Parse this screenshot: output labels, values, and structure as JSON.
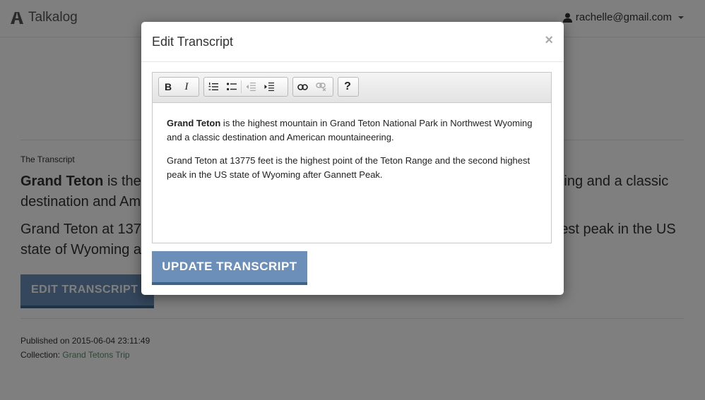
{
  "app": {
    "brand": "Talkalog",
    "user_email": "rachelle@gmail.com"
  },
  "page": {
    "section_label": "The Transcript",
    "paragraph1_bold": "Grand Teton",
    "paragraph1_rest": " is the highest mountain in Grand Teton National Park in Northwest Wyoming and a classic destination and American mountaineering.",
    "paragraph2": "Grand Teton at 13775 feet is the highest point of the Teton Range and the second highest peak in the US state of Wyoming after Gannett Peak.",
    "edit_button": "EDIT TRANSCRIPT",
    "published_label": "Published on 2015-06-04 23:11:49",
    "collection_label": "Collection: ",
    "collection_link": "Grand Tetons Trip"
  },
  "modal": {
    "title": "Edit Transcript",
    "close_symbol": "×",
    "toolbar": {
      "bold": "B",
      "italic": "I",
      "help": "?"
    },
    "content": {
      "paragraph1_bold": "Grand Teton",
      "paragraph1_rest": " is the highest mountain in Grand Teton National Park in Northwest Wyoming and a classic destination and American mountaineering.",
      "paragraph2": "Grand Teton at 13775 feet is the highest point of the Teton Range and the second highest peak in the US state of Wyoming after Gannett Peak."
    },
    "update_button": "UPDATE TRANSCRIPT"
  },
  "icons": [
    "logo-icon",
    "user-icon",
    "ordered-list-icon",
    "unordered-list-icon",
    "outdent-icon",
    "indent-icon",
    "link-icon",
    "unlink-icon"
  ],
  "colors": {
    "accent_button": "#6b8fb8",
    "button_border": "#3e6389",
    "link": "#5a8f6a",
    "backdrop": "rgba(0,0,0,0.5)"
  }
}
